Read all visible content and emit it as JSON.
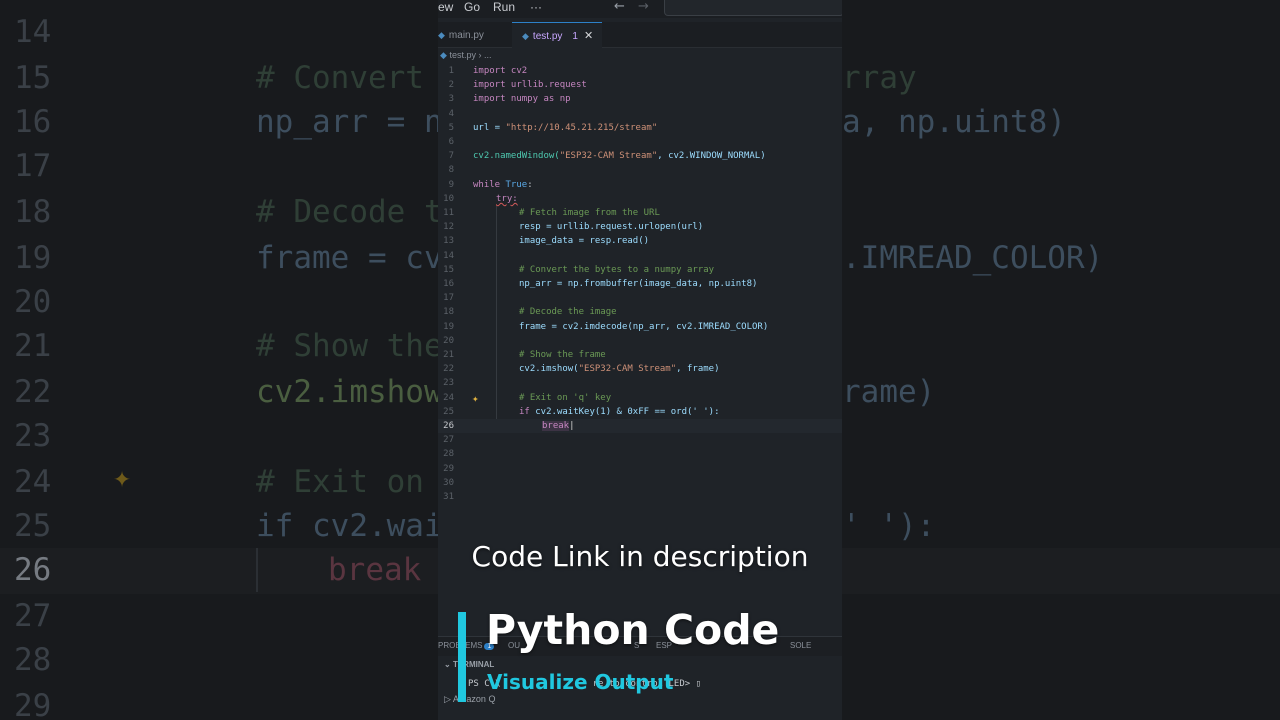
{
  "menu": {
    "items": [
      "ew",
      "Go",
      "Run"
    ],
    "more": "···",
    "back_arrow": "←",
    "forward_arrow": "→"
  },
  "tabs": [
    {
      "label": "main.py",
      "active": false
    },
    {
      "label": "test.py",
      "active": true,
      "badge": "1"
    }
  ],
  "breadcrumb": {
    "file": "test.py",
    "sep": "›",
    "more": "..."
  },
  "code_lines": [
    {
      "n": "1"
    },
    {
      "n": "2"
    },
    {
      "n": "3"
    },
    {
      "n": "4"
    },
    {
      "n": "5"
    },
    {
      "n": "6"
    },
    {
      "n": "7"
    },
    {
      "n": "8"
    },
    {
      "n": "9"
    },
    {
      "n": "10"
    },
    {
      "n": "11"
    },
    {
      "n": "12"
    },
    {
      "n": "13"
    },
    {
      "n": "14"
    },
    {
      "n": "15"
    },
    {
      "n": "16"
    },
    {
      "n": "17"
    },
    {
      "n": "18"
    },
    {
      "n": "19"
    },
    {
      "n": "20"
    },
    {
      "n": "21"
    },
    {
      "n": "22"
    },
    {
      "n": "23"
    },
    {
      "n": "24"
    },
    {
      "n": "25"
    },
    {
      "n": "26"
    },
    {
      "n": "27"
    },
    {
      "n": "28"
    },
    {
      "n": "29"
    },
    {
      "n": "30"
    },
    {
      "n": "31"
    }
  ],
  "code": {
    "l1": "import cv2",
    "l2": "import urllib.request",
    "l3": "import numpy as np",
    "l5_a": "url = ",
    "l5_b": "\"http://10.45.21.215/stream\"",
    "l7_a": "cv2.namedWindow(",
    "l7_b": "\"ESP32-CAM Stream\"",
    "l7_c": ", cv2.WINDOW_NORMAL)",
    "l9_a": "while ",
    "l9_b": "True",
    "l9_c": ":",
    "l10": "try:",
    "l11": "# Fetch image from the URL",
    "l12": "resp = urllib.request.urlopen(url)",
    "l13": "image_data = resp.read()",
    "l15": "# Convert the bytes to a numpy array",
    "l16": "np_arr = np.frombuffer(image_data, np.uint8)",
    "l18": "# Decode the image",
    "l19": "frame = cv2.imdecode(np_arr, cv2.IMREAD_COLOR)",
    "l21": "# Show the frame",
    "l22_a": "cv2.imshow(",
    "l22_b": "\"ESP32-CAM Stream\"",
    "l22_c": ", frame)",
    "l24": "# Exit on 'q' key",
    "l25_a": "if ",
    "l25_b": "cv2.waitKey(1) & 0xFF == ord(' '):",
    "l26": "break"
  },
  "background": {
    "lines": [
      {
        "n": "14",
        "text": ""
      },
      {
        "n": "15",
        "text": "# Convert"
      },
      {
        "n": "16",
        "text": "np_arr = n"
      },
      {
        "n": "17",
        "text": ""
      },
      {
        "n": "18",
        "text": "# Decode t"
      },
      {
        "n": "19",
        "text": "frame = cv"
      },
      {
        "n": "20",
        "text": ""
      },
      {
        "n": "21",
        "text": "# Show the"
      },
      {
        "n": "22",
        "text": "cv2.imshow"
      },
      {
        "n": "23",
        "text": ""
      },
      {
        "n": "24",
        "text": "# Exit on"
      },
      {
        "n": "25",
        "text": "if cv2.wai"
      },
      {
        "n": "26",
        "text": "break"
      },
      {
        "n": "27",
        "text": ""
      },
      {
        "n": "28",
        "text": ""
      },
      {
        "n": "29",
        "text": ""
      }
    ],
    "right_fragments": {
      "r15": "rray",
      "r16": "a, np.uint8)",
      "r19": ".IMREAD_COLOR)",
      "r22": "rame)",
      "r25": "' '):"
    }
  },
  "panel": {
    "tabs": [
      "PROBLEMS",
      "OU",
      "S",
      "ESP",
      "SOLE"
    ],
    "problems_badge": "1",
    "terminal_label": "TERMINAL",
    "terminal_line": "PS C:\\                 re to control LED> ▯",
    "amazon_q": "▷ Amazon Q"
  },
  "overlay": {
    "caption": "Code Link in description",
    "title": "Python Code",
    "subtitle": "Visualize Output"
  },
  "colors": {
    "accent": "#20c8e0",
    "tab_active": "#c8a7ff",
    "sparkle": "#e2b340"
  }
}
